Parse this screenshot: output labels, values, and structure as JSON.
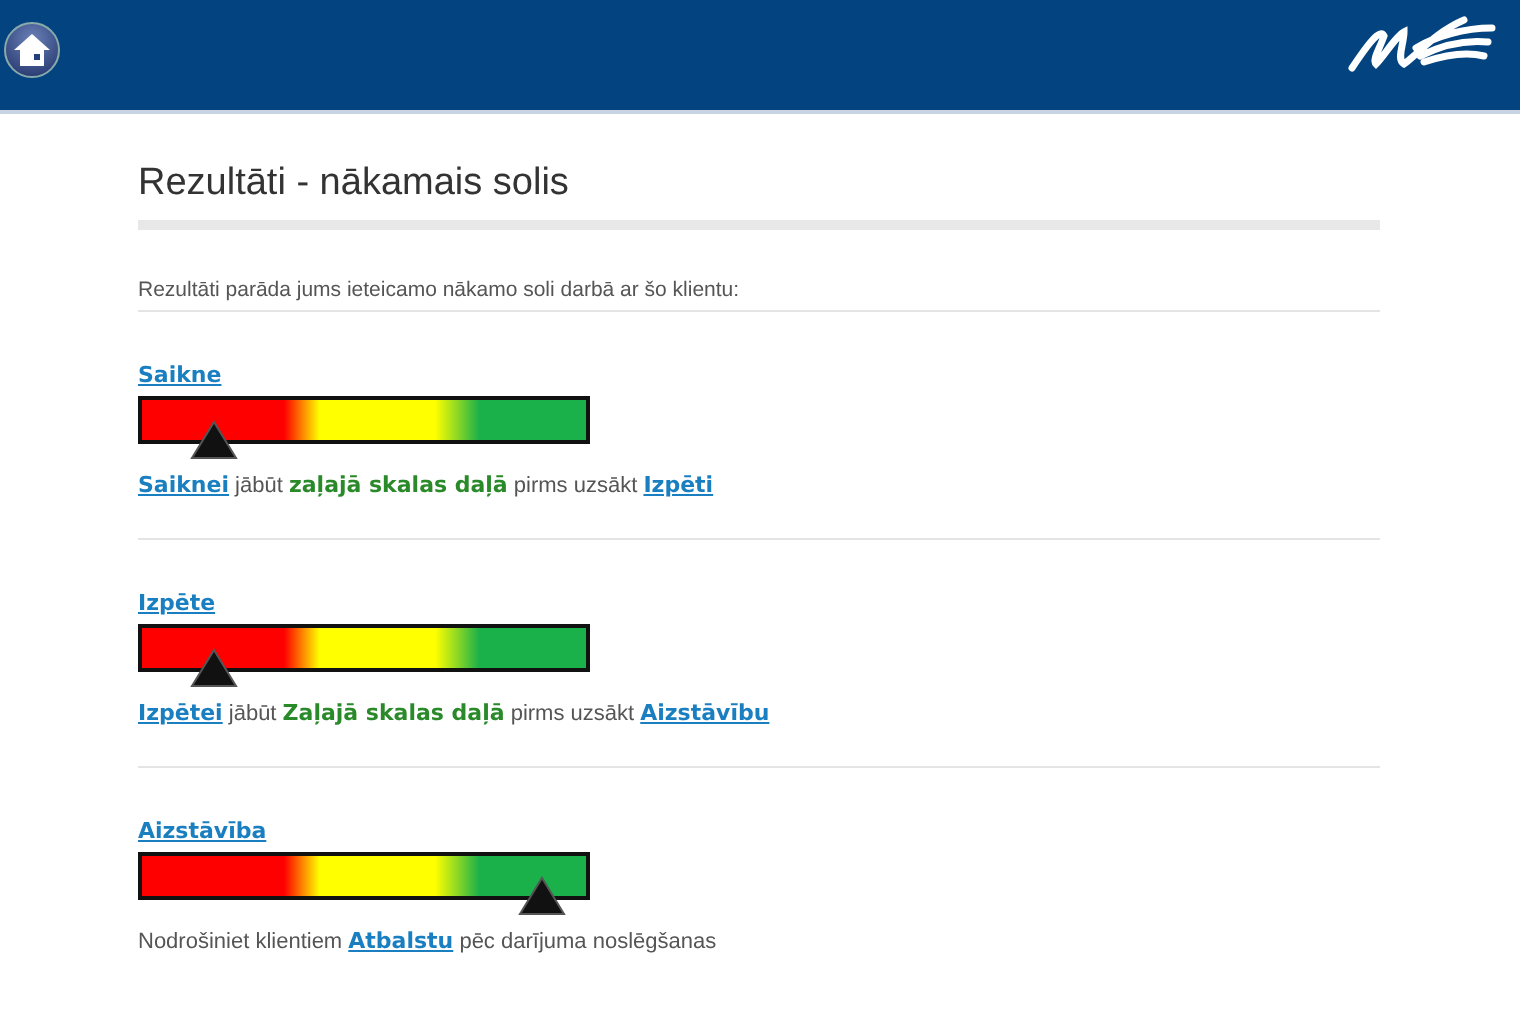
{
  "title": "Rezultāti - nākamais solis",
  "intro": "Rezultāti parāda jums ieteicamo nākamo soli darbā ar šo klientu:",
  "sections": [
    {
      "label": "Saikne",
      "level": 0.16,
      "sentence": [
        {
          "kind": "link",
          "text": "Saiknei"
        },
        {
          "kind": "plain",
          "text": " jābūt "
        },
        {
          "kind": "emphasis",
          "text": "zaļajā skalas daļā"
        },
        {
          "kind": "plain",
          "text": " pirms uzsākt "
        },
        {
          "kind": "link",
          "text": "Izpēti"
        }
      ]
    },
    {
      "label": "Izpēte",
      "level": 0.16,
      "sentence": [
        {
          "kind": "link",
          "text": "Izpētei"
        },
        {
          "kind": "plain",
          "text": " jābūt "
        },
        {
          "kind": "emphasis",
          "text": "Zaļajā skalas daļā"
        },
        {
          "kind": "plain",
          "text": " pirms uzsākt "
        },
        {
          "kind": "link",
          "text": "Aizstāvību"
        }
      ]
    },
    {
      "label": "Aizstāvība",
      "level": 0.9,
      "sentence": [
        {
          "kind": "plain",
          "text": "Nodrošiniet klientiem "
        },
        {
          "kind": "link",
          "text": "Atbalstu"
        },
        {
          "kind": "plain",
          "text": " pēc darījuma noslēgšanas"
        }
      ]
    }
  ]
}
